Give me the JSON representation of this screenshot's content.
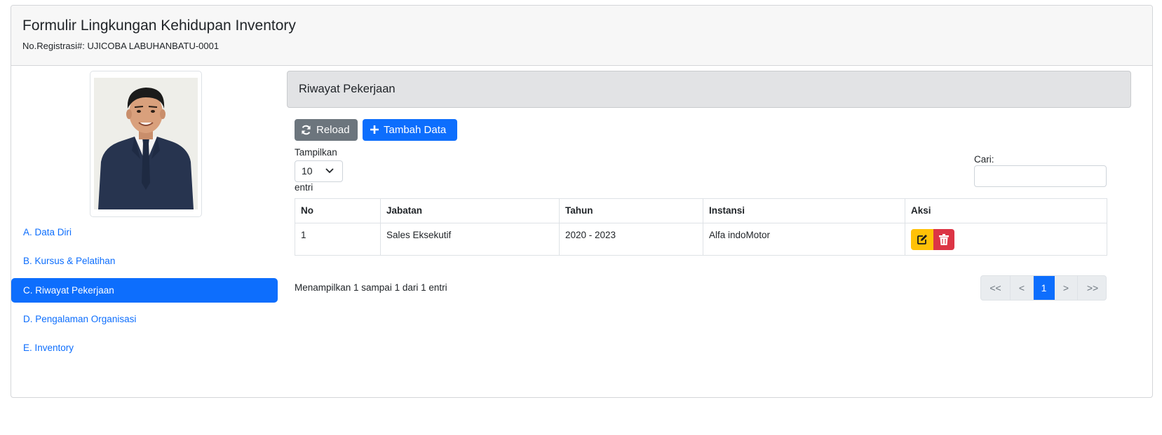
{
  "header": {
    "title": "Formulir Lingkungan Kehidupan Inventory",
    "registration": "No.Registrasi#: UJICOBA LABUHANBATU-0001"
  },
  "sidebar": {
    "items": [
      {
        "label": "A. Data Diri",
        "active": false
      },
      {
        "label": "B. Kursus & Pelatihan",
        "active": false
      },
      {
        "label": "C. Riwayat Pekerjaan",
        "active": true
      },
      {
        "label": "D. Pengalaman Organisasi",
        "active": false
      },
      {
        "label": "E. Inventory",
        "active": false
      }
    ]
  },
  "section": {
    "title": "Riwayat Pekerjaan"
  },
  "toolbar": {
    "reload_label": "Reload",
    "add_label": "Tambah Data"
  },
  "length": {
    "show_label": "Tampilkan",
    "value": "10",
    "entries_label": "entri"
  },
  "search": {
    "label": "Cari:",
    "value": "",
    "placeholder": ""
  },
  "table": {
    "headers": [
      "No",
      "Jabatan",
      "Tahun",
      "Instansi",
      "Aksi"
    ],
    "rows": [
      {
        "no": "1",
        "jabatan": "Sales Eksekutif",
        "tahun": "2020 - 2023",
        "instansi": "Alfa indoMotor"
      }
    ]
  },
  "info": "Menampilkan 1 sampai 1 dari 1 entri",
  "pagination": {
    "first": "<<",
    "prev": "<",
    "current": "1",
    "next": ">",
    "last": ">>"
  },
  "icons": {
    "reload": "sync-icon",
    "add": "plus-icon",
    "select": "chevron-down-icon",
    "edit": "edit-icon",
    "delete": "trash-icon"
  },
  "colors": {
    "primary": "#0d6efd",
    "secondary": "#6c757d",
    "warning": "#ffc107",
    "danger": "#dc3545"
  }
}
